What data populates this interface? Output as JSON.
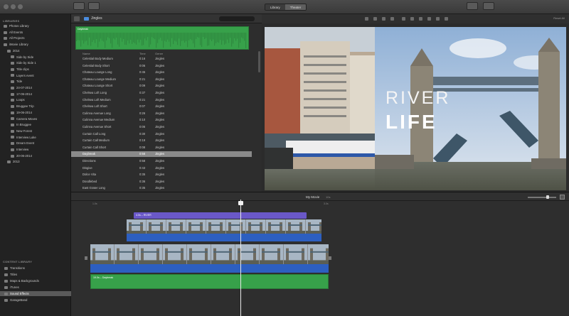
{
  "toolbar": {
    "segments": [
      "Library",
      "Theater"
    ]
  },
  "sidebar": {
    "libraries_header": "LIBRARIES",
    "items": [
      {
        "label": "Photos Library",
        "indent": 0,
        "selected": false
      },
      {
        "label": "All Events",
        "indent": 0,
        "selected": false
      },
      {
        "label": "All Projects",
        "indent": 0,
        "selected": false
      },
      {
        "label": "iMovie Library",
        "indent": 0,
        "selected": false
      },
      {
        "label": "2014",
        "indent": 1,
        "selected": false
      },
      {
        "label": "Side by Side",
        "indent": 2,
        "selected": false
      },
      {
        "label": "Side by Side 1",
        "indent": 2,
        "selected": false
      },
      {
        "label": "Title clips",
        "indent": 2,
        "selected": false
      },
      {
        "label": "Layers event",
        "indent": 2,
        "selected": false
      },
      {
        "label": "Tide",
        "indent": 2,
        "selected": false
      },
      {
        "label": "24-07-2014",
        "indent": 2,
        "selected": false
      },
      {
        "label": "17-06-2014",
        "indent": 2,
        "selected": false
      },
      {
        "label": "Loops",
        "indent": 2,
        "selected": false
      },
      {
        "label": "Bruggee Trip",
        "indent": 2,
        "selected": false
      },
      {
        "label": "19-06-2014",
        "indent": 2,
        "selected": false
      },
      {
        "label": "Camera Moves",
        "indent": 2,
        "selected": false
      },
      {
        "label": "In Bruggee",
        "indent": 2,
        "selected": false
      },
      {
        "label": "New Forest",
        "indent": 2,
        "selected": false
      },
      {
        "label": "Interview Luke",
        "indent": 2,
        "selected": false
      },
      {
        "label": "Dream Event",
        "indent": 2,
        "selected": false
      },
      {
        "label": "Interview",
        "indent": 2,
        "selected": false
      },
      {
        "label": "20-06-2014",
        "indent": 2,
        "selected": false
      },
      {
        "label": "2013",
        "indent": 1,
        "selected": false
      }
    ],
    "content_header": "CONTENT LIBRARY",
    "content_items": [
      {
        "label": "Transitions",
        "selected": false
      },
      {
        "label": "Titles",
        "selected": false
      },
      {
        "label": "Maps & Backgrounds",
        "selected": false
      },
      {
        "label": "iTunes",
        "selected": false
      },
      {
        "label": "Sound Effects",
        "selected": true
      },
      {
        "label": "GarageBand",
        "selected": false
      }
    ]
  },
  "browser": {
    "folder_title": "Jingles",
    "waveform_label": "Daybreak",
    "columns": {
      "name": "Name",
      "time": "Time",
      "genre": "Genre"
    },
    "rows": [
      {
        "name": "Celestial Body Medium",
        "time": "0:16",
        "genre": "Jingles",
        "selected": false
      },
      {
        "name": "Celestial Body Short",
        "time": "0:06",
        "genre": "Jingles",
        "selected": false
      },
      {
        "name": "Chateau Lounge Long",
        "time": "0:45",
        "genre": "Jingles",
        "selected": false
      },
      {
        "name": "Chateau Lounge Medium",
        "time": "0:21",
        "genre": "Jingles",
        "selected": false
      },
      {
        "name": "Chateau Lounge Short",
        "time": "0:09",
        "genre": "Jingles",
        "selected": false
      },
      {
        "name": "Chelsea Loft Long",
        "time": "0:37",
        "genre": "Jingles",
        "selected": false
      },
      {
        "name": "Chelsea Loft Medium",
        "time": "0:21",
        "genre": "Jingles",
        "selected": false
      },
      {
        "name": "Chelsea Loft Short",
        "time": "0:07",
        "genre": "Jingles",
        "selected": false
      },
      {
        "name": "Culinna Avenue Long",
        "time": "0:26",
        "genre": "Jingles",
        "selected": false
      },
      {
        "name": "Culinna Avenue Medium",
        "time": "0:10",
        "genre": "Jingles",
        "selected": false
      },
      {
        "name": "Culinna Avenue Short",
        "time": "0:06",
        "genre": "Jingles",
        "selected": false
      },
      {
        "name": "Curtain Call Long",
        "time": "0:30",
        "genre": "Jingles",
        "selected": false
      },
      {
        "name": "Curtain Call Medium",
        "time": "0:19",
        "genre": "Jingles",
        "selected": false
      },
      {
        "name": "Curtain Call Short",
        "time": "0:08",
        "genre": "Jingles",
        "selected": false
      },
      {
        "name": "Daybreak",
        "time": "0:56",
        "genre": "Jingles",
        "selected": true
      },
      {
        "name": "Directions",
        "time": "0:58",
        "genre": "Jingles",
        "selected": false
      },
      {
        "name": "Disgive",
        "time": "0:43",
        "genre": "Jingles",
        "selected": false
      },
      {
        "name": "Dolce Vita",
        "time": "0:35",
        "genre": "Jingles",
        "selected": false
      },
      {
        "name": "Doodlebed",
        "time": "0:36",
        "genre": "Jingles",
        "selected": false
      },
      {
        "name": "East Grater Long",
        "time": "0:35",
        "genre": "Jingles",
        "selected": false
      }
    ]
  },
  "viewer": {
    "reset_all": "Reset All",
    "title_line1": "RIVER",
    "title_line2": "LIFE"
  },
  "timeline": {
    "project_title": "My Movie",
    "duration": "10s",
    "ruler": [
      "1.0s",
      "3.0s"
    ],
    "title_clip_label": "4.0s – RIVER",
    "audio_clip_label": "19.0s – Daybreak"
  },
  "colors": {
    "accent_green": "#37a14a",
    "title_bar_purple": "#6a58c8",
    "video_strip_blue": "#2d5fc0"
  }
}
